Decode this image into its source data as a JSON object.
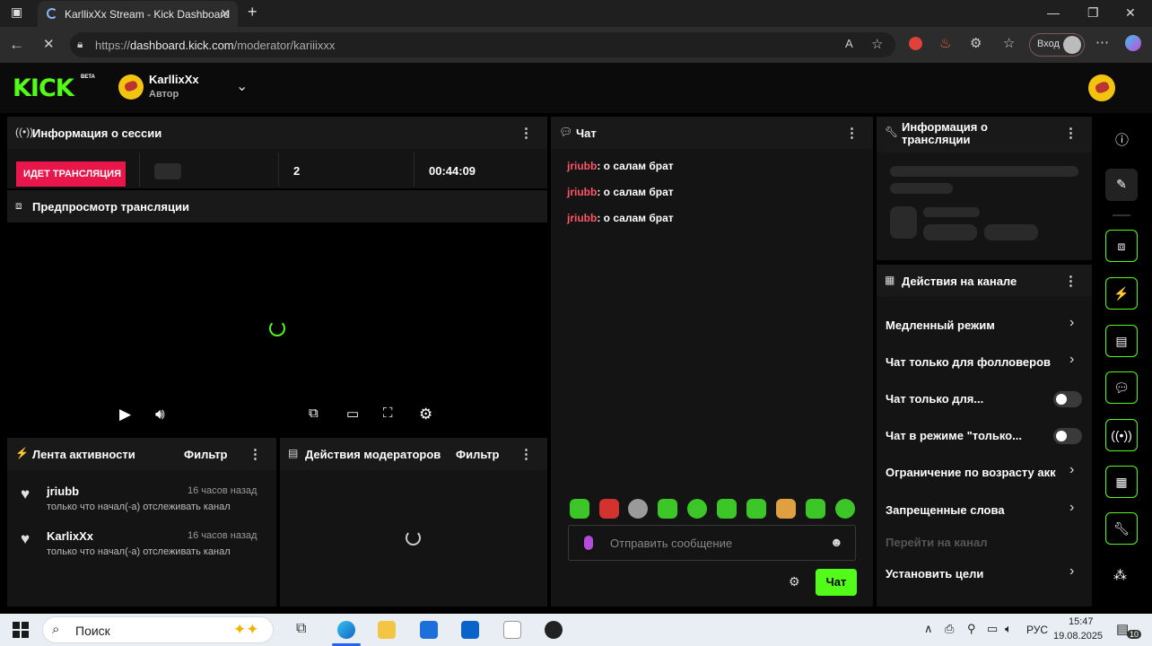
{
  "browser": {
    "tab_title": "KarllixXx Stream - Kick Dashboard",
    "url_prefix": "https://",
    "url_domain": "dashboard.kick.com",
    "url_path": "/moderator/kariiixxx",
    "login_label": "Вход"
  },
  "header": {
    "logo": "KICK",
    "beta": "BETA",
    "username": "KarllixXx",
    "role": "Автор"
  },
  "session": {
    "title": "Информация о сессии",
    "live_badge": "ИДЕТ ТРАНСЛЯЦИЯ",
    "viewers": "2",
    "duration": "00:44:09"
  },
  "preview": {
    "title": "Предпросмотр трансляции"
  },
  "activity": {
    "title": "Лента активности",
    "filter": "Фильтр",
    "items": [
      {
        "name": "jriubb",
        "time": "16 часов назад",
        "desc": "только что начал(-а) отслеживать канал"
      },
      {
        "name": "KarlixXx",
        "time": "16 часов назад",
        "desc": "только что начал(-а) отслеживать канал"
      }
    ]
  },
  "mod_actions": {
    "title": "Действия модераторов",
    "filter": "Фильтр"
  },
  "chat": {
    "title": "Чат",
    "messages": [
      {
        "user": "jriubb",
        "text": ": о салам брат"
      },
      {
        "user": "jriubb",
        "text": ": о салам брат"
      },
      {
        "user": "jriubb",
        "text": ": о салам брат"
      }
    ],
    "placeholder": "Отправить сообщение",
    "send_label": "Чат"
  },
  "stream_info": {
    "title": "Информация о трансляции"
  },
  "channel_actions": {
    "title": "Действия на канале",
    "items": [
      {
        "label": "Медленный режим",
        "control": "arrow"
      },
      {
        "label": "Чат только для фолловеров",
        "control": "arrow"
      },
      {
        "label": "Чат только для...",
        "control": "toggle"
      },
      {
        "label": "Чат в режиме \"только...",
        "control": "toggle"
      },
      {
        "label": "Ограничение по возрасту акк",
        "control": "arrow"
      },
      {
        "label": "Запрещенные слова",
        "control": "arrow"
      },
      {
        "label": "Перейти на канал",
        "control": "none"
      },
      {
        "label": "Установить цели",
        "control": "arrow"
      }
    ]
  },
  "taskbar": {
    "search_label": "Поиск",
    "lang": "РУС",
    "time": "15:47",
    "date": "19.08.2025",
    "notif_count": "10"
  },
  "colors": {
    "accent": "#53fc18",
    "live": "#e8164a",
    "chat_user": "#ff5566"
  }
}
